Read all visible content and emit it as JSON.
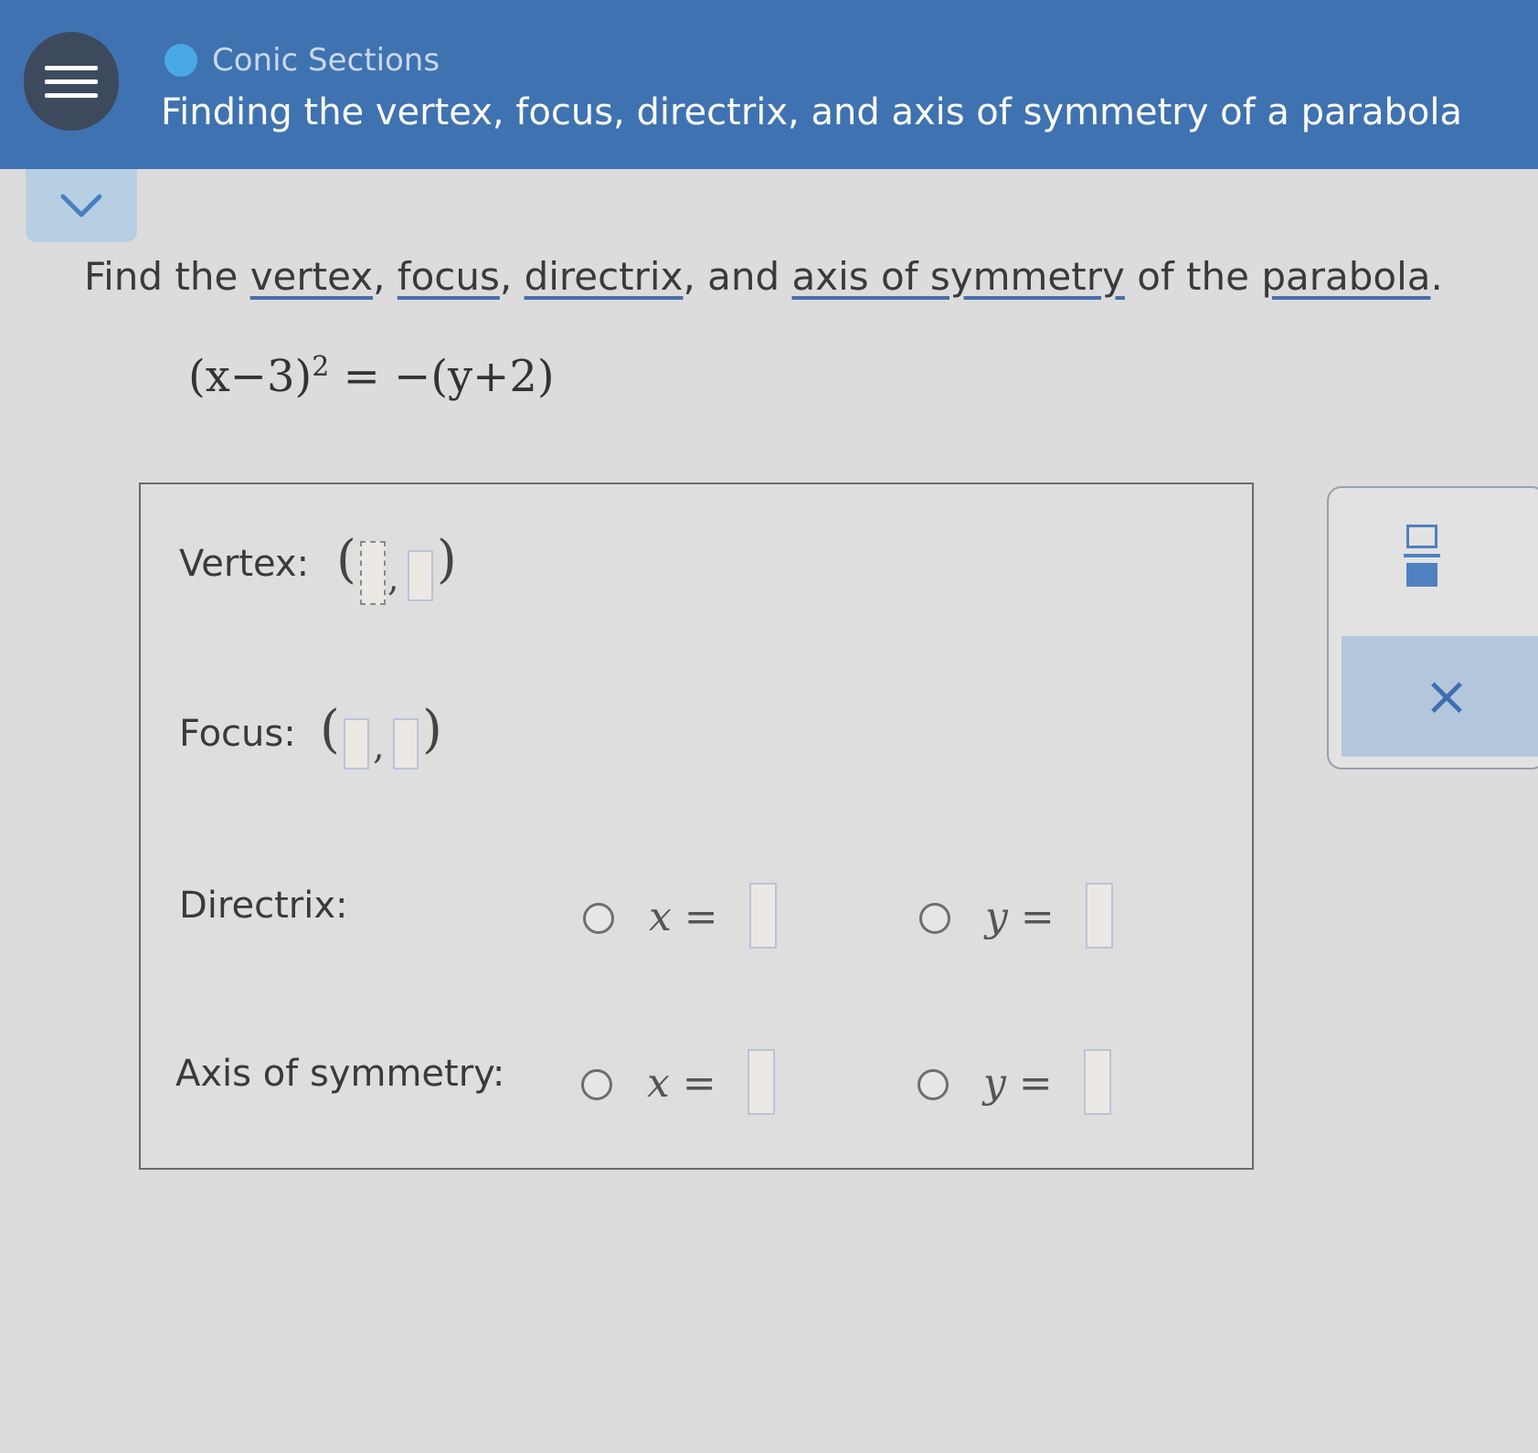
{
  "header": {
    "topic": "Conic Sections",
    "title": "Finding the vertex, focus, directrix, and axis of symmetry of a parabola"
  },
  "question": {
    "prefix": "Find the ",
    "term1": "vertex",
    "sep1": ", ",
    "term2": "focus",
    "sep2": ", ",
    "term3": "directrix",
    "sep3": ", and ",
    "term4": "axis of symmetry",
    "mid": " of the ",
    "term5": "parabola",
    "suffix": "."
  },
  "equation": {
    "left": "(x−3)",
    "exponent": "2",
    "right": " = −(y+2)"
  },
  "answers": {
    "vertex_label": "Vertex:",
    "focus_label": "Focus:",
    "directrix_label": "Directrix:",
    "axis_label": "Axis of symmetry:",
    "open_paren": "(",
    "close_paren": ")",
    "comma": ",",
    "x_eq": "x =",
    "y_eq": "y ="
  },
  "toolbar": {
    "clear_symbol": "×"
  },
  "colors": {
    "header_bg": "#3f72b0",
    "accent": "#4f80c0"
  }
}
